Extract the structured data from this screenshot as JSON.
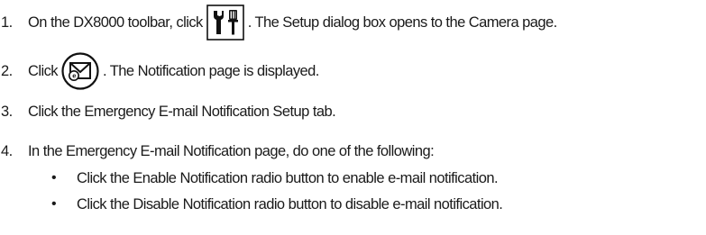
{
  "steps": [
    {
      "number": "1.",
      "text_before": "On the DX8000 toolbar, click",
      "icon": "setup-tools-icon",
      "text_after": ". The Setup dialog box opens to the Camera page."
    },
    {
      "number": "2.",
      "text_before": "Click",
      "icon": "email-notification-icon",
      "text_after": ". The Notification page is displayed."
    },
    {
      "number": "3.",
      "text": "Click the Emergency E-mail Notification Setup tab."
    },
    {
      "number": "4.",
      "text": "In the Emergency E-mail Notification page, do one of the following:",
      "bullets": [
        "Click the Enable Notification radio button to enable e-mail notification.",
        "Click the Disable Notification radio button to disable e-mail notification."
      ],
      "bullet_char": "•"
    }
  ]
}
